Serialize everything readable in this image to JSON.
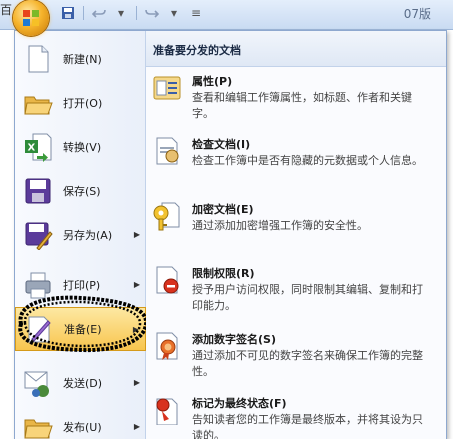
{
  "window": {
    "clipped_char": "百",
    "doc_title": "07版",
    "qat": {
      "save": "save-icon",
      "undo": "undo-icon",
      "redo": "redo-icon",
      "customize": "customize-icon"
    }
  },
  "menu": {
    "left_items": [
      {
        "label": "新建(N)",
        "icon": "new-document-icon",
        "has_arrow": false
      },
      {
        "label": "打开(O)",
        "icon": "open-folder-icon",
        "has_arrow": false
      },
      {
        "label": "转换(V)",
        "icon": "convert-icon",
        "has_arrow": false
      },
      {
        "label": "保存(S)",
        "icon": "save-icon",
        "has_arrow": false
      },
      {
        "label": "另存为(A)",
        "icon": "save-as-icon",
        "has_arrow": true
      },
      {
        "label": "打印(P)",
        "icon": "print-icon",
        "has_arrow": true
      },
      {
        "label": "准备(E)",
        "icon": "prepare-icon",
        "has_arrow": true,
        "active": true
      },
      {
        "label": "发送(D)",
        "icon": "send-icon",
        "has_arrow": true
      },
      {
        "label": "发布(U)",
        "icon": "publish-icon",
        "has_arrow": true
      }
    ],
    "right_header": "准备要分发的文档",
    "right_items": [
      {
        "title": "属性(P)",
        "desc": "查看和编辑工作簿属性，如标题、作者和关键字。",
        "icon": "properties-icon"
      },
      {
        "title": "检查文档(I)",
        "desc": "检查工作簿中是否有隐藏的元数据或个人信息。",
        "icon": "inspect-document-icon"
      },
      {
        "title": "加密文档(E)",
        "desc": "通过添加加密增强工作簿的安全性。",
        "icon": "encrypt-document-icon"
      },
      {
        "title": "限制权限(R)",
        "desc": "授予用户访问权限，同时限制其编辑、复制和打印能力。",
        "icon": "restrict-permission-icon"
      },
      {
        "title": "添加数字签名(S)",
        "desc": "通过添加不可见的数字签名来确保工作簿的完整性。",
        "icon": "digital-signature-icon"
      },
      {
        "title": "标记为最终状态(F)",
        "desc": "告知读者您的工作簿是最终版本，并将其设为只读的。",
        "icon": "mark-final-icon"
      }
    ],
    "accent": "#f8c54e"
  }
}
